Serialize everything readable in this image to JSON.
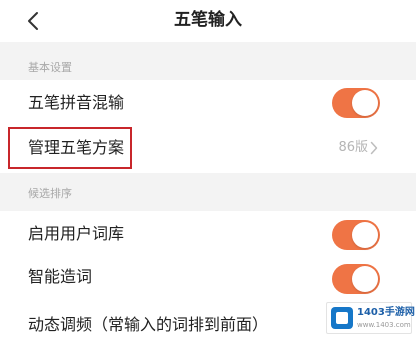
{
  "header": {
    "title": "五笔输入"
  },
  "sections": [
    {
      "label": "基本设置",
      "items": [
        {
          "label": "五笔拼音混输",
          "toggle_on": true
        },
        {
          "label": "管理五笔方案",
          "value": "86版"
        }
      ]
    },
    {
      "label": "候选排序",
      "items": [
        {
          "label": "启用用户词库",
          "toggle_on": true
        },
        {
          "label": "智能造词",
          "toggle_on": true
        },
        {
          "label": "动态调频（常输入的词排到前面）"
        }
      ]
    }
  ],
  "highlight": {
    "target": "管理五笔方案",
    "color": "#c8262b"
  },
  "watermark": {
    "title": "1403手游网",
    "subtitle": "www.1403.com"
  },
  "colors": {
    "toggle_on": "#ef7445",
    "section_bg": "#f3f3f3",
    "text_primary": "#222222",
    "text_secondary": "#a8a8a8"
  },
  "icons": {
    "back": "chevron-left-icon",
    "row_arrow": "chevron-right-icon"
  }
}
